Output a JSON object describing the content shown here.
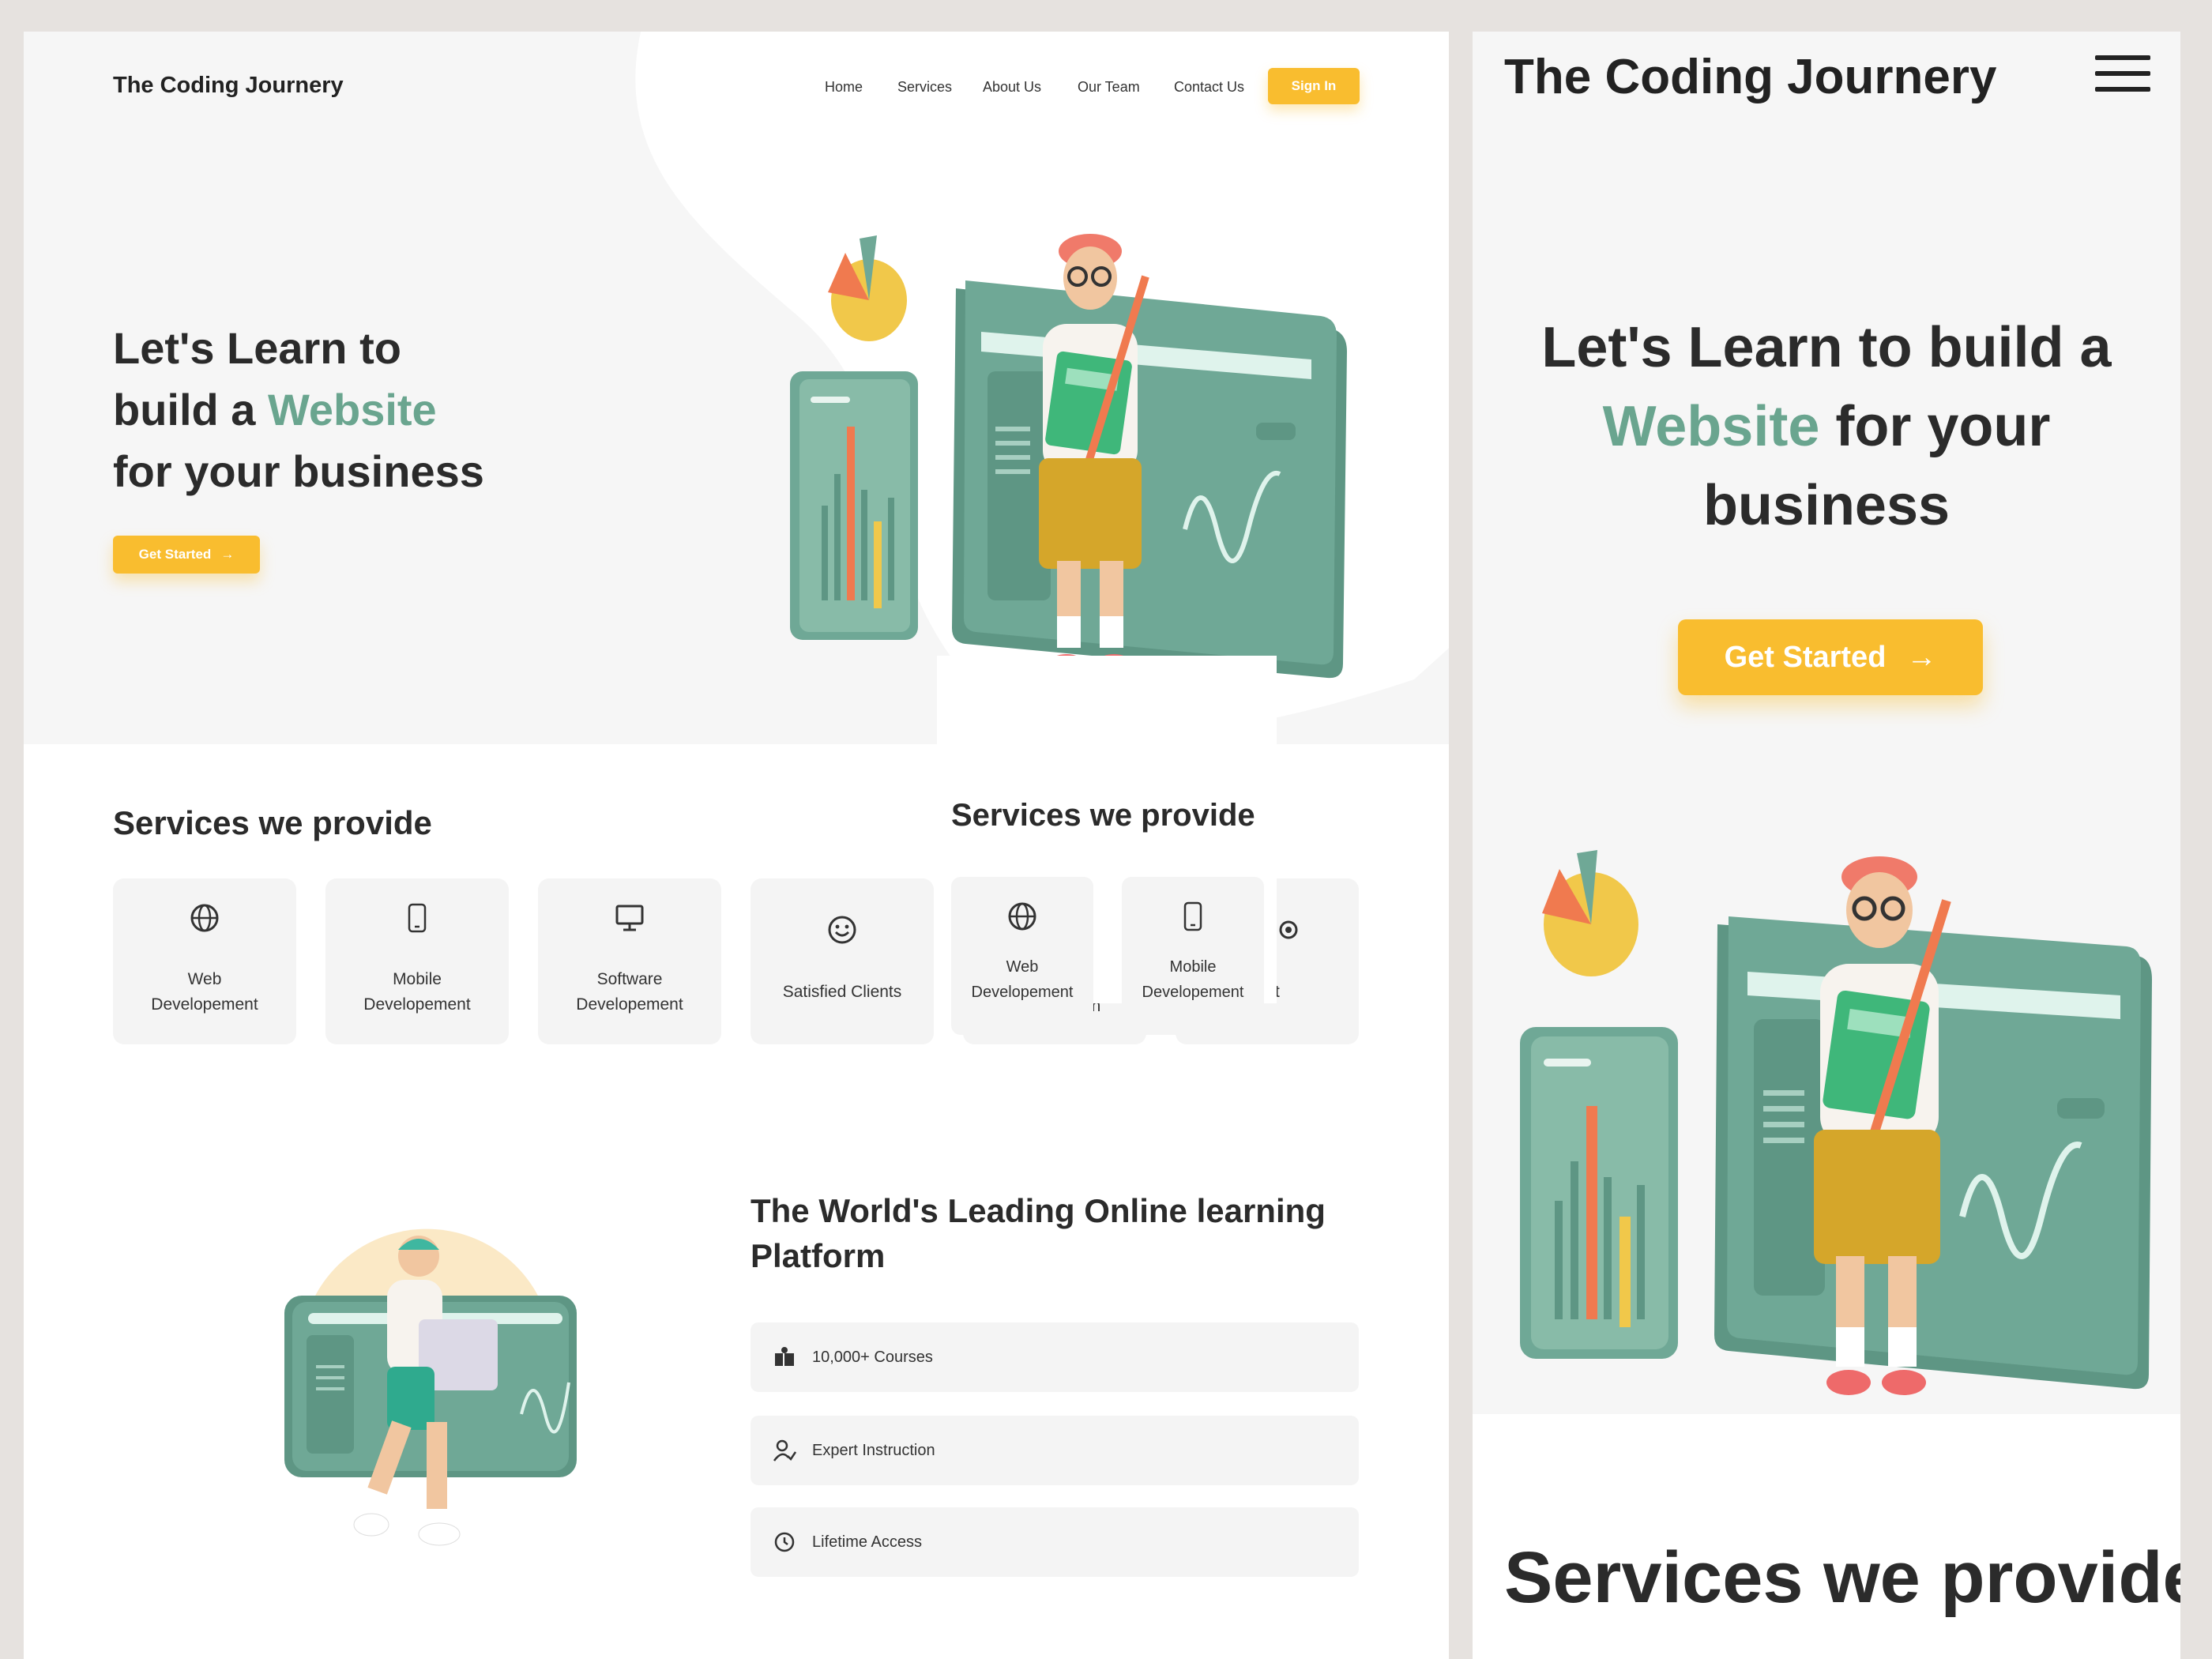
{
  "desktop": {
    "logo": "The Coding Journery",
    "nav": {
      "home": "Home",
      "services": "Services",
      "about": "About Us",
      "team": "Our Team",
      "contact": "Contact Us",
      "signin": "Sign In"
    },
    "hero": {
      "line1": "Let's Learn to",
      "line2_pre": "build a ",
      "line2_accent": "Website",
      "line3": "for your business",
      "cta": "Get Started"
    },
    "services": {
      "title": "Services we provide",
      "cards": [
        {
          "line1": "Web",
          "line2": "Developement",
          "icon": "globe-icon"
        },
        {
          "line1": "Mobile",
          "line2": "Developement",
          "icon": "mobile-icon"
        },
        {
          "line1": "Software",
          "line2": "Developement",
          "icon": "monitor-icon"
        },
        {
          "line1": "Satisfied Clients",
          "icon": "smiley-icon"
        },
        {
          "line1": "Optimization"
        },
        {
          "line1": "pport",
          "icon": "gear-icon"
        }
      ]
    },
    "overlay": {
      "title": "Services we provide",
      "cards": [
        {
          "line1": "Web",
          "line2": "Developement",
          "icon": "globe-icon"
        },
        {
          "line1": "Mobile",
          "line2": "Developement",
          "icon": "mobile-icon"
        }
      ]
    },
    "learning": {
      "title_line1": "The World's Leading Online learning",
      "title_line2": "Platform",
      "features": [
        {
          "label": "10,000+ Courses",
          "icon": "courses-icon"
        },
        {
          "label": "Expert Instruction",
          "icon": "instructor-icon"
        },
        {
          "label": "Lifetime Access",
          "icon": "clock-icon"
        }
      ]
    }
  },
  "mobile": {
    "logo": "The Coding Journery",
    "hero": {
      "line1": "Let's Learn to build a",
      "line2_accent": "Website",
      "line2_post": " for your",
      "line3": "business",
      "cta": "Get Started"
    },
    "services_title": "Services we provide"
  },
  "colors": {
    "accent_green": "#6aa58f",
    "cta_yellow": "#f9bd2f",
    "teal_panel": "#6fa896"
  }
}
